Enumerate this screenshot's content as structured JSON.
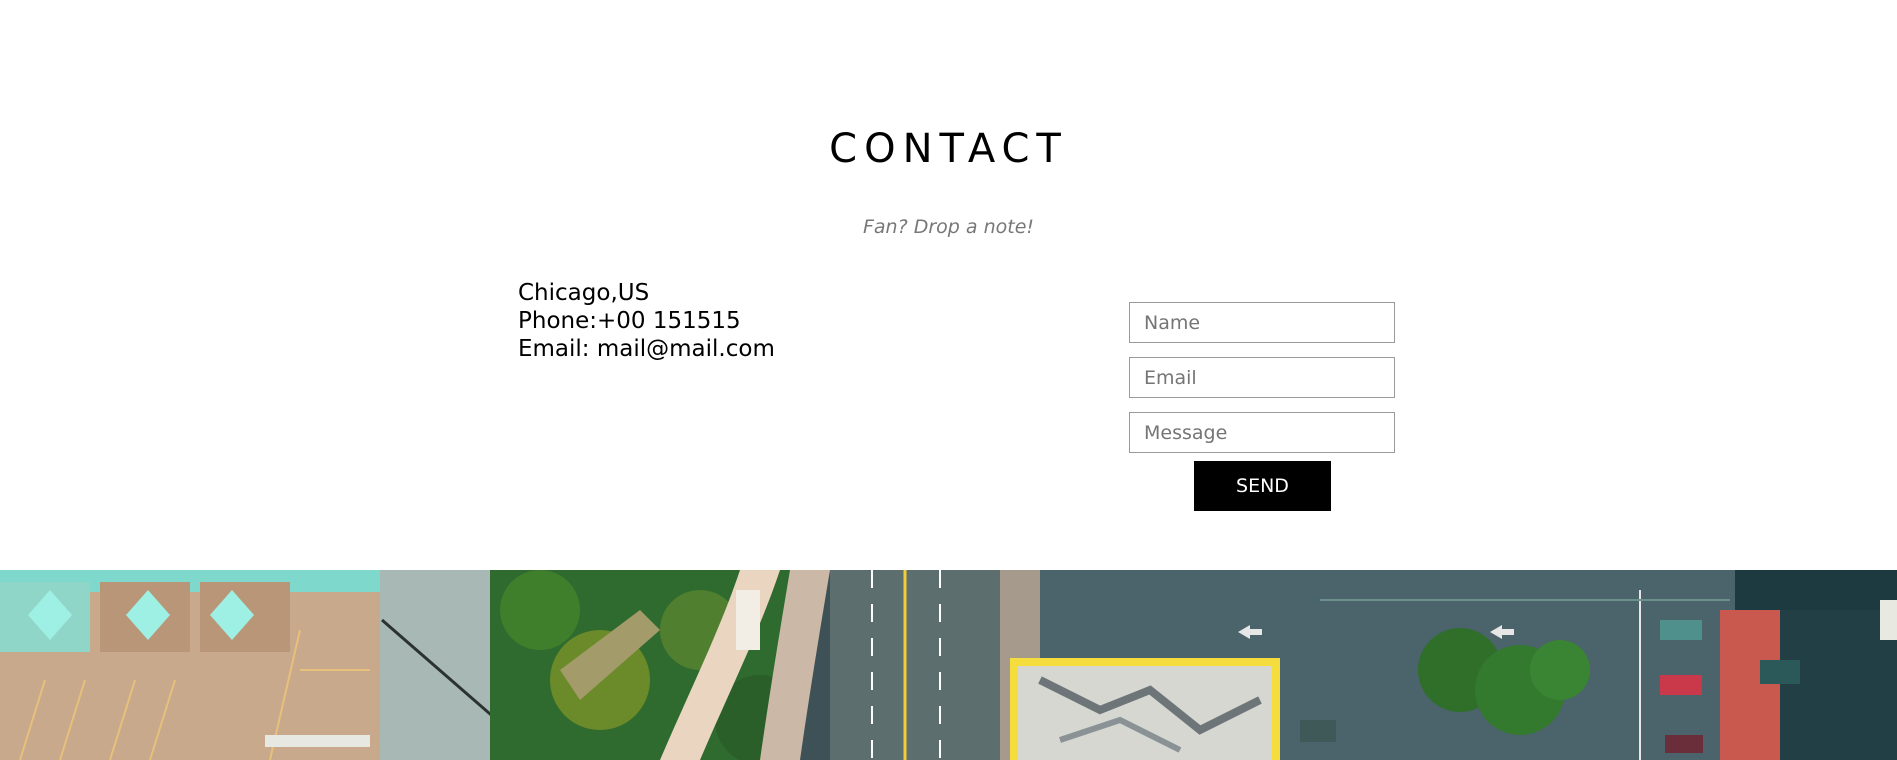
{
  "contact": {
    "title": "CONTACT",
    "subtitle": "Fan? Drop a note!",
    "info": {
      "location": "Chicago,US",
      "phone": "Phone:+00 151515",
      "email": "Email: mail@mail.com"
    },
    "form": {
      "name_placeholder": "Name",
      "email_placeholder": "Email",
      "message_placeholder": "Message",
      "send_label": "SEND"
    }
  },
  "colors": {
    "top_bar": "#1a1819",
    "button_bg": "#000000",
    "button_text": "#ffffff",
    "subtitle": "#777777"
  },
  "footer_image": {
    "icon": "aerial-city-photo",
    "description_visible": false
  }
}
